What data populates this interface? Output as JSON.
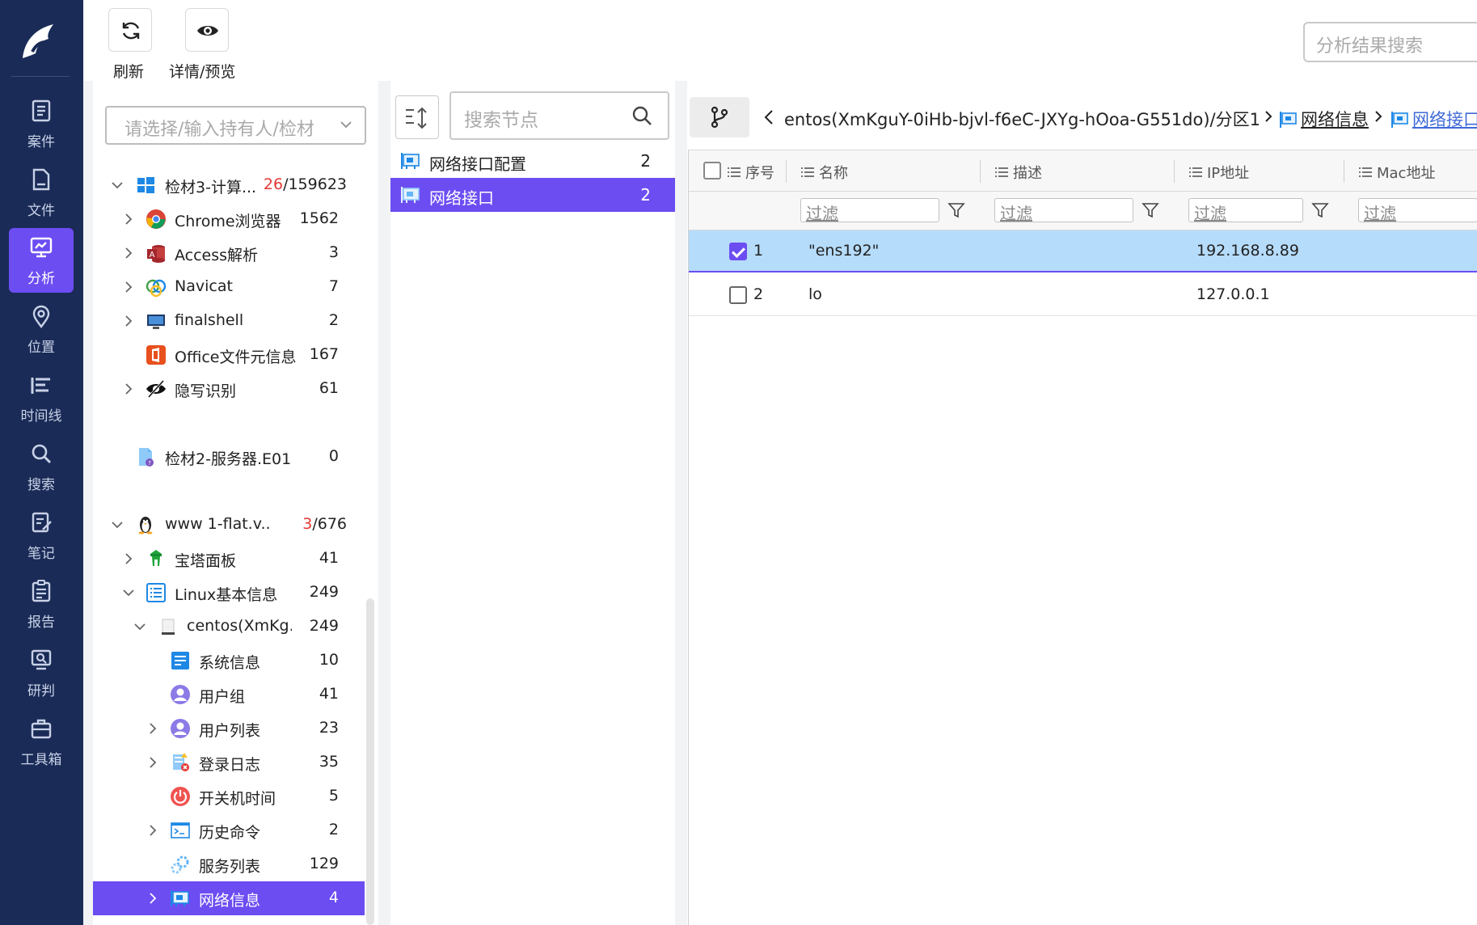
{
  "nav": {
    "items": [
      {
        "label": "案件",
        "icon": "case-icon"
      },
      {
        "label": "文件",
        "icon": "file-icon"
      },
      {
        "label": "分析",
        "icon": "analysis-icon",
        "active": true
      },
      {
        "label": "位置",
        "icon": "location-icon"
      },
      {
        "label": "时间线",
        "icon": "timeline-icon"
      },
      {
        "label": "搜索",
        "icon": "search-icon"
      },
      {
        "label": "笔记",
        "icon": "note-icon"
      },
      {
        "label": "报告",
        "icon": "report-icon"
      },
      {
        "label": "研判",
        "icon": "judge-icon"
      },
      {
        "label": "工具箱",
        "icon": "toolbox-icon"
      }
    ]
  },
  "toolbar": {
    "refresh_label": "刷新",
    "preview_label": "详情/预览",
    "result_search_placeholder": "分析结果搜索"
  },
  "tree": {
    "holder_placeholder": "请选择/输入持有人/检材",
    "rows": [
      {
        "name": "检材3-计算...",
        "count_red": "26",
        "count_rest": "/159623",
        "icon": "windows-icon"
      },
      {
        "name": "Chrome浏览器",
        "count": "1562",
        "icon": "chrome-icon"
      },
      {
        "name": "Access解析",
        "count": "3",
        "icon": "access-icon"
      },
      {
        "name": "Navicat",
        "count": "7",
        "icon": "navicat-icon"
      },
      {
        "name": "finalshell",
        "count": "2",
        "icon": "finalshell-icon"
      },
      {
        "name": "Office文件元信息",
        "count": "167",
        "icon": "office-icon"
      },
      {
        "name": "隐写识别",
        "count": "61",
        "icon": "stego-icon"
      },
      {
        "name": "检材2-服务器.E01",
        "count": "0",
        "icon": "evidence-file-icon"
      },
      {
        "name": "www 1-flat.v...",
        "count_red": "3",
        "count_rest": "/676",
        "icon": "linux-icon"
      },
      {
        "name": "宝塔面板",
        "count": "41",
        "icon": "baota-icon"
      },
      {
        "name": "Linux基本信息",
        "count": "249",
        "icon": "list-icon"
      },
      {
        "name": "centos(XmKg...",
        "count": "249",
        "icon": "disk-icon"
      },
      {
        "name": "系统信息",
        "count": "10",
        "icon": "sysinfo-icon"
      },
      {
        "name": "用户组",
        "count": "41",
        "icon": "usergroup-icon"
      },
      {
        "name": "用户列表",
        "count": "23",
        "icon": "userlist-icon"
      },
      {
        "name": "登录日志",
        "count": "35",
        "icon": "loginlog-icon"
      },
      {
        "name": "开关机时间",
        "count": "5",
        "icon": "power-icon"
      },
      {
        "name": "历史命令",
        "count": "2",
        "icon": "terminal-icon"
      },
      {
        "name": "服务列表",
        "count": "129",
        "icon": "service-icon"
      },
      {
        "name": "网络信息",
        "count": "4",
        "icon": "network-icon"
      }
    ]
  },
  "nodes": {
    "search_placeholder": "搜索节点",
    "items": [
      {
        "name": "网络接口配置",
        "count": "2"
      },
      {
        "name": "网络接口",
        "count": "2"
      }
    ]
  },
  "breadcrumb": {
    "path": "entos(XmKguY-0iHb-bjvl-f6eC-JXYg-hOoa-G551do)/分区1",
    "node1": "网络信息",
    "node2": "网络接口"
  },
  "table": {
    "columns": [
      "序号",
      "名称",
      "描述",
      "IP地址",
      "Mac地址"
    ],
    "filter_placeholder": "过滤",
    "rows": [
      {
        "index": "1",
        "name": "\"ens192\"",
        "desc": "",
        "ip": "192.168.8.89",
        "mac": "",
        "checked": true
      },
      {
        "index": "2",
        "name": "lo",
        "desc": "",
        "ip": "127.0.0.1",
        "mac": "",
        "checked": false
      }
    ]
  },
  "colors": {
    "nav_bg": "#1a2b57",
    "accent": "#6c4df2",
    "row_highlight": "#b6dcfb"
  }
}
